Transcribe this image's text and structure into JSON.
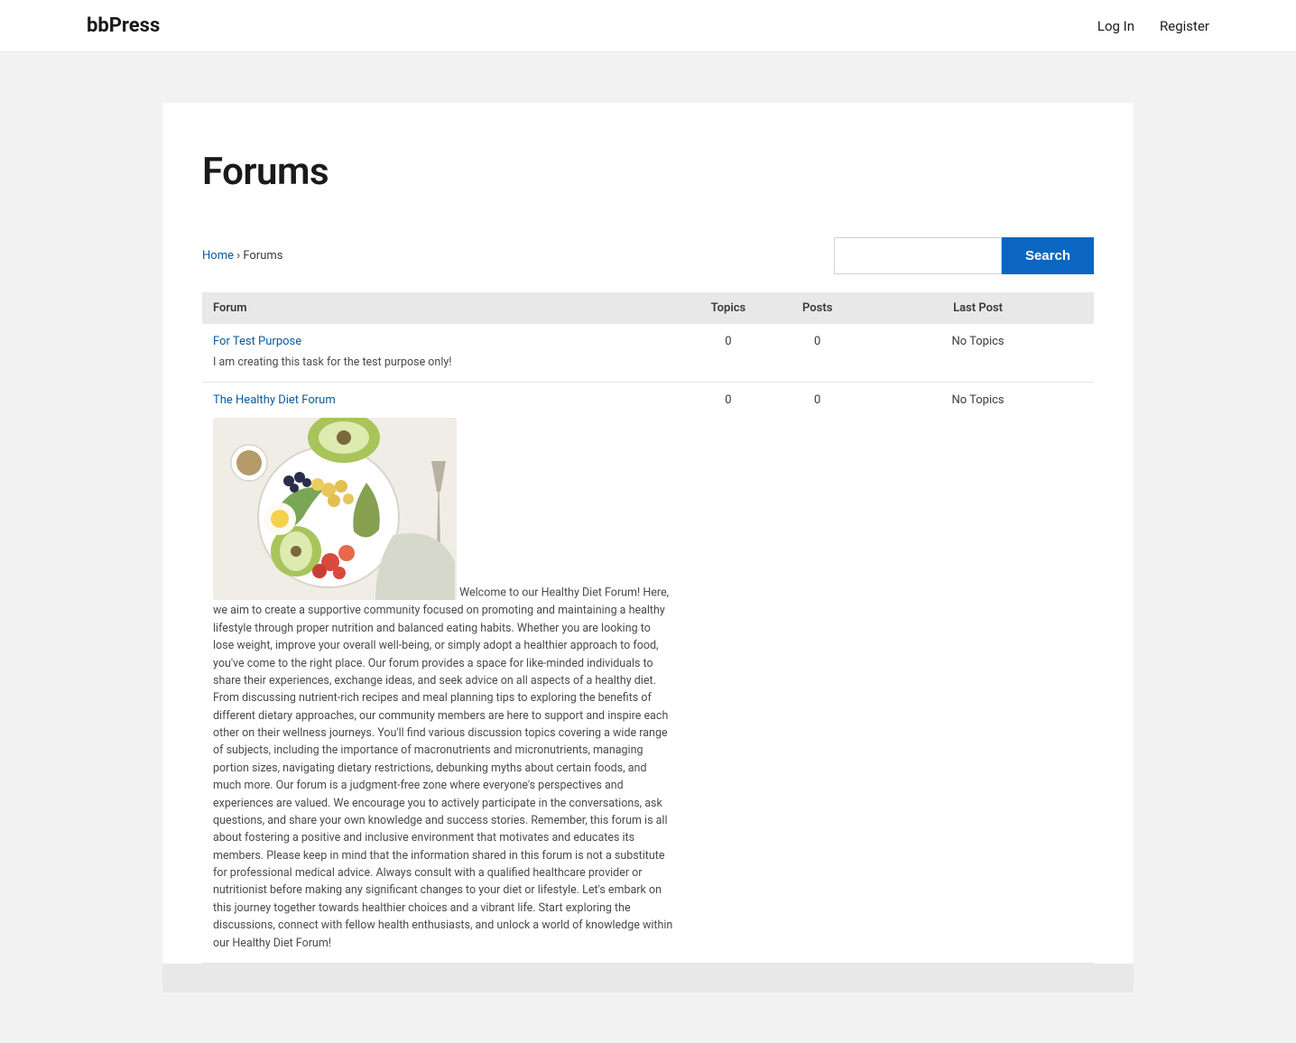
{
  "site_title": "bbPress",
  "nav": {
    "login": "Log In",
    "register": "Register"
  },
  "page_title": "Forums",
  "breadcrumb": {
    "home": "Home",
    "sep": " › ",
    "current": "Forums"
  },
  "search": {
    "placeholder": "",
    "button": "Search"
  },
  "table_headers": {
    "forum": "Forum",
    "topics": "Topics",
    "posts": "Posts",
    "last": "Last Post"
  },
  "forums": [
    {
      "title": "For Test Purpose",
      "desc": "I am creating this task for the test purpose only!",
      "topics": "0",
      "posts": "0",
      "last": "No Topics",
      "has_image": false
    },
    {
      "title": "The Healthy Diet Forum",
      "desc_prefix": " Welcome to our Healthy Diet Forum! Here, we aim to create ",
      "desc_rest": "a supportive community focused on promoting and maintaining a healthy lifestyle through proper nutrition and balanced eating habits. Whether you are looking to lose weight, improve your overall well-being, or simply adopt a healthier approach to food, you've come to the right place. Our forum provides a space for like-minded individuals to share their experiences, exchange ideas, and seek advice on all aspects of a healthy diet. From discussing nutrient-rich recipes and meal planning tips to exploring the benefits of different dietary approaches, our community members are here to support and inspire each other on their wellness journeys. You'll find various discussion topics covering a wide range of subjects, including the importance of macronutrients and micronutrients, managing portion sizes, navigating dietary restrictions, debunking myths about certain foods, and much more. Our forum is a judgment-free zone where everyone's perspectives and experiences are valued. We encourage you to actively participate in the conversations, ask questions, and share your own knowledge and success stories. Remember, this forum is all about fostering a positive and inclusive environment that motivates and educates its members. Please keep in mind that the information shared in this forum is not a substitute for professional medical advice. Always consult with a qualified healthcare provider or nutritionist before making any significant changes to your diet or lifestyle. Let's embark on this journey together towards healthier choices and a vibrant life. Start exploring the discussions, connect with fellow health enthusiasts, and unlock a world of knowledge within our Healthy Diet Forum!",
      "topics": "0",
      "posts": "0",
      "last": "No Topics",
      "has_image": true
    }
  ]
}
